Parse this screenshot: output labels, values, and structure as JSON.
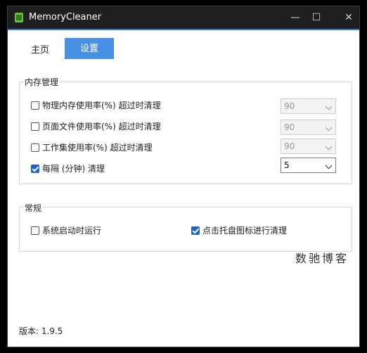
{
  "window": {
    "title": "MemoryCleaner",
    "minimize_glyph": "—",
    "maximize_glyph": "☐",
    "close_glyph": "✕"
  },
  "nav": {
    "home_label": "主页",
    "settings_label": "设置"
  },
  "memory_group": {
    "label": "内存管理",
    "items": [
      {
        "label": "物理内存使用率(%) 超过时清理",
        "checked": false,
        "value": "90",
        "enabled": false
      },
      {
        "label": "页面文件使用率(%) 超过时清理",
        "checked": false,
        "value": "90",
        "enabled": false
      },
      {
        "label": "工作集使用率(%) 超过时清理",
        "checked": false,
        "value": "90",
        "enabled": false
      },
      {
        "label": "每隔 (分钟) 清理",
        "checked": true,
        "value": "5",
        "enabled": true
      }
    ]
  },
  "general_group": {
    "label": "常规",
    "items": [
      {
        "label": "系统启动时运行",
        "checked": false
      },
      {
        "label": "点击托盘图标进行清理",
        "checked": true
      }
    ]
  },
  "watermark": "数驰博客",
  "version": "版本: 1.9.5",
  "colors": {
    "accent": "#4a90e2",
    "checkbox": "#1f63c6",
    "titlebar": "#1f1f1f"
  }
}
